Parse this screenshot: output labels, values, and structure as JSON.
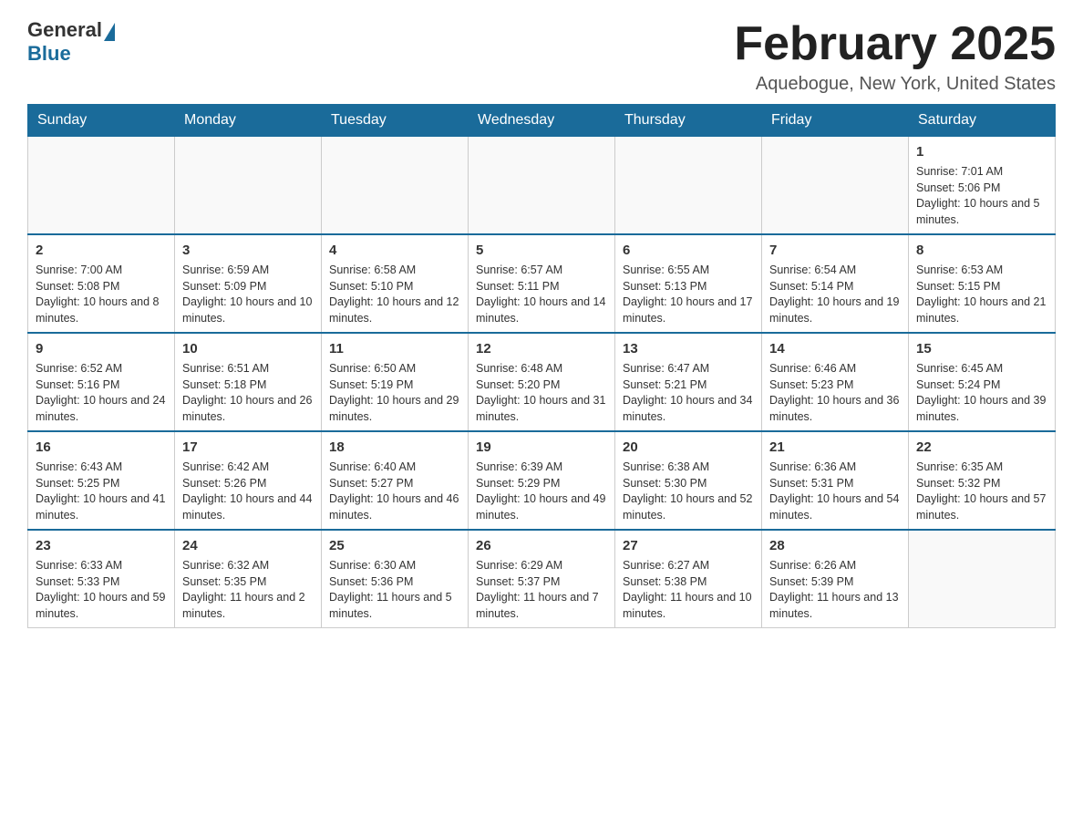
{
  "header": {
    "logo_general": "General",
    "logo_blue": "Blue",
    "month_title": "February 2025",
    "location": "Aquebogue, New York, United States"
  },
  "days_of_week": [
    "Sunday",
    "Monday",
    "Tuesday",
    "Wednesday",
    "Thursday",
    "Friday",
    "Saturday"
  ],
  "weeks": [
    [
      {
        "day": "",
        "info": ""
      },
      {
        "day": "",
        "info": ""
      },
      {
        "day": "",
        "info": ""
      },
      {
        "day": "",
        "info": ""
      },
      {
        "day": "",
        "info": ""
      },
      {
        "day": "",
        "info": ""
      },
      {
        "day": "1",
        "info": "Sunrise: 7:01 AM\nSunset: 5:06 PM\nDaylight: 10 hours and 5 minutes."
      }
    ],
    [
      {
        "day": "2",
        "info": "Sunrise: 7:00 AM\nSunset: 5:08 PM\nDaylight: 10 hours and 8 minutes."
      },
      {
        "day": "3",
        "info": "Sunrise: 6:59 AM\nSunset: 5:09 PM\nDaylight: 10 hours and 10 minutes."
      },
      {
        "day": "4",
        "info": "Sunrise: 6:58 AM\nSunset: 5:10 PM\nDaylight: 10 hours and 12 minutes."
      },
      {
        "day": "5",
        "info": "Sunrise: 6:57 AM\nSunset: 5:11 PM\nDaylight: 10 hours and 14 minutes."
      },
      {
        "day": "6",
        "info": "Sunrise: 6:55 AM\nSunset: 5:13 PM\nDaylight: 10 hours and 17 minutes."
      },
      {
        "day": "7",
        "info": "Sunrise: 6:54 AM\nSunset: 5:14 PM\nDaylight: 10 hours and 19 minutes."
      },
      {
        "day": "8",
        "info": "Sunrise: 6:53 AM\nSunset: 5:15 PM\nDaylight: 10 hours and 21 minutes."
      }
    ],
    [
      {
        "day": "9",
        "info": "Sunrise: 6:52 AM\nSunset: 5:16 PM\nDaylight: 10 hours and 24 minutes."
      },
      {
        "day": "10",
        "info": "Sunrise: 6:51 AM\nSunset: 5:18 PM\nDaylight: 10 hours and 26 minutes."
      },
      {
        "day": "11",
        "info": "Sunrise: 6:50 AM\nSunset: 5:19 PM\nDaylight: 10 hours and 29 minutes."
      },
      {
        "day": "12",
        "info": "Sunrise: 6:48 AM\nSunset: 5:20 PM\nDaylight: 10 hours and 31 minutes."
      },
      {
        "day": "13",
        "info": "Sunrise: 6:47 AM\nSunset: 5:21 PM\nDaylight: 10 hours and 34 minutes."
      },
      {
        "day": "14",
        "info": "Sunrise: 6:46 AM\nSunset: 5:23 PM\nDaylight: 10 hours and 36 minutes."
      },
      {
        "day": "15",
        "info": "Sunrise: 6:45 AM\nSunset: 5:24 PM\nDaylight: 10 hours and 39 minutes."
      }
    ],
    [
      {
        "day": "16",
        "info": "Sunrise: 6:43 AM\nSunset: 5:25 PM\nDaylight: 10 hours and 41 minutes."
      },
      {
        "day": "17",
        "info": "Sunrise: 6:42 AM\nSunset: 5:26 PM\nDaylight: 10 hours and 44 minutes."
      },
      {
        "day": "18",
        "info": "Sunrise: 6:40 AM\nSunset: 5:27 PM\nDaylight: 10 hours and 46 minutes."
      },
      {
        "day": "19",
        "info": "Sunrise: 6:39 AM\nSunset: 5:29 PM\nDaylight: 10 hours and 49 minutes."
      },
      {
        "day": "20",
        "info": "Sunrise: 6:38 AM\nSunset: 5:30 PM\nDaylight: 10 hours and 52 minutes."
      },
      {
        "day": "21",
        "info": "Sunrise: 6:36 AM\nSunset: 5:31 PM\nDaylight: 10 hours and 54 minutes."
      },
      {
        "day": "22",
        "info": "Sunrise: 6:35 AM\nSunset: 5:32 PM\nDaylight: 10 hours and 57 minutes."
      }
    ],
    [
      {
        "day": "23",
        "info": "Sunrise: 6:33 AM\nSunset: 5:33 PM\nDaylight: 10 hours and 59 minutes."
      },
      {
        "day": "24",
        "info": "Sunrise: 6:32 AM\nSunset: 5:35 PM\nDaylight: 11 hours and 2 minutes."
      },
      {
        "day": "25",
        "info": "Sunrise: 6:30 AM\nSunset: 5:36 PM\nDaylight: 11 hours and 5 minutes."
      },
      {
        "day": "26",
        "info": "Sunrise: 6:29 AM\nSunset: 5:37 PM\nDaylight: 11 hours and 7 minutes."
      },
      {
        "day": "27",
        "info": "Sunrise: 6:27 AM\nSunset: 5:38 PM\nDaylight: 11 hours and 10 minutes."
      },
      {
        "day": "28",
        "info": "Sunrise: 6:26 AM\nSunset: 5:39 PM\nDaylight: 11 hours and 13 minutes."
      },
      {
        "day": "",
        "info": ""
      }
    ]
  ]
}
